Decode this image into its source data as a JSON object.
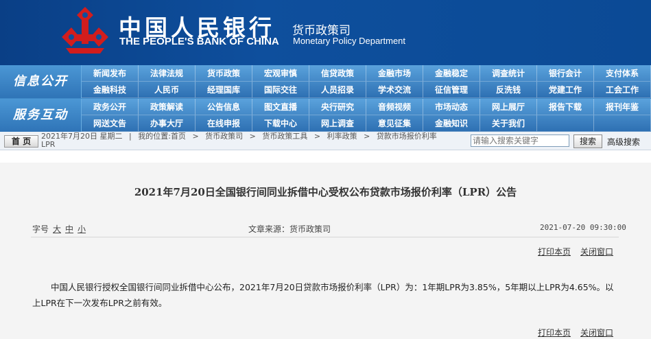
{
  "header": {
    "bank_name_cn": "中国人民银行",
    "bank_name_en": "THE PEOPLE'S BANK OF CHINA",
    "dept_cn": "货币政策司",
    "dept_en": "Monetary Policy Department",
    "brand_color": "#0e4f9d",
    "logo_color": "#d21d1d"
  },
  "nav": {
    "band1_label": "信息公开",
    "band2_label": "服务互动",
    "band1_items": [
      "新闻发布",
      "法律法规",
      "货币政策",
      "宏观审慎",
      "信贷政策",
      "金融市场",
      "金融稳定",
      "调查统计",
      "银行会计",
      "支付体系",
      "金融科技",
      "人民币",
      "经理国库",
      "国际交往",
      "人员招录",
      "学术交流",
      "征信管理",
      "反洗钱",
      "党建工作",
      "工会工作"
    ],
    "band2_items": [
      "政务公开",
      "政策解读",
      "公告信息",
      "图文直播",
      "央行研究",
      "音频视频",
      "市场动态",
      "网上展厅",
      "报告下载",
      "报刊年鉴",
      "网送文告",
      "办事大厅",
      "在线申报",
      "下载中心",
      "网上调查",
      "意见征集",
      "金融知识",
      "关于我们",
      "",
      ""
    ]
  },
  "crumbbar": {
    "home": "首 页",
    "date": "2021年7月20日 星期二",
    "location_label": "我的位置:",
    "crumbs": [
      "首页",
      "货币政策司",
      "货币政策工具",
      "利率政策",
      "贷款市场报价利率"
    ],
    "crumb_tail": "LPR",
    "search_placeholder": "请输入搜索关键字",
    "search_button": "搜索",
    "advanced_search": "高级搜索"
  },
  "article": {
    "title": "2021年7月20日全国银行间同业拆借中心受权公布贷款市场报价利率（LPR）公告",
    "font_size_label": "字号",
    "font_sizes": [
      "大",
      "中",
      "小"
    ],
    "source": "文章来源：货币政策司",
    "datetime": "2021-07-20 09:30:00",
    "print_label": "打印本页",
    "close_label": "关闭窗口",
    "body": "中国人民银行授权全国银行间同业拆借中心公布，2021年7月20日贷款市场报价利率（LPR）为：1年期LPR为3.85%，5年期以上LPR为4.65%。以上LPR在下一次发布LPR之前有效。"
  }
}
